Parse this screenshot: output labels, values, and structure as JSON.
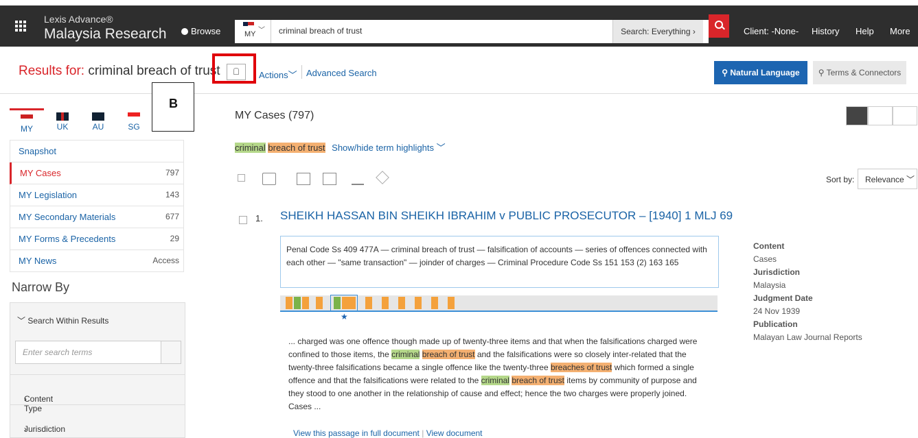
{
  "header": {
    "brand_top": "Lexis Advance®",
    "brand_main": "Malaysia Research",
    "browse_label": "Browse",
    "search": {
      "jurisdiction": "MY",
      "query": "criminal breach of trust",
      "scope_label": "Search: Everything",
      "scope_chevron": "›"
    },
    "nav": [
      "Client: -None-",
      "History",
      "Help",
      "More"
    ]
  },
  "results_bar": {
    "label": "Results for:",
    "query": "criminal breach of trust",
    "actions_label": "Actions",
    "advanced_search_label": "Advanced Search",
    "natural_language_label": "Natural Language",
    "terms_connectors_label": "Terms & Connectors"
  },
  "callout_label": "B",
  "jurisdiction_tabs": [
    {
      "code": "MY",
      "active": true
    },
    {
      "code": "UK",
      "active": false
    },
    {
      "code": "AU",
      "active": false
    },
    {
      "code": "SG",
      "active": false
    }
  ],
  "sidebar": {
    "items": [
      {
        "label": "Snapshot",
        "count": ""
      },
      {
        "label": "MY Cases",
        "count": "797"
      },
      {
        "label": "MY Legislation",
        "count": "143"
      },
      {
        "label": "MY Secondary Materials",
        "count": "677"
      },
      {
        "label": "MY Forms & Precedents",
        "count": "29"
      },
      {
        "label": "MY News",
        "count": "Access"
      }
    ],
    "narrow_by_label": "Narrow By",
    "search_within_label": "Search Within Results",
    "search_within_placeholder": "Enter search terms",
    "facets": [
      "Content Type",
      "Jurisdiction"
    ]
  },
  "main": {
    "cases_title": "MY Cases (797)",
    "terms": {
      "t1": "criminal",
      "t2": "breach of trust",
      "toggle_label": "Show/hide term highlights"
    },
    "sort_label": "Sort by:",
    "sort_value": "Relevance",
    "result": {
      "number": "1.",
      "title": "SHEIKH HASSAN BIN SHEIKH IBRAHIM v PUBLIC PROSECUTOR – [1940] 1 MLJ 69",
      "summary": "Penal Code Ss 409 477A — criminal breach of trust — falsification of accounts — series of offences connected with each other — \"same transaction\" — joinder of charges — Criminal Procedure Code Ss 151 153 (2) 163 165",
      "snippet": {
        "s1": "... charged was one offence though made up of twenty-three items and that when the falsifications charged were confined to those items, the ",
        "h1": "criminal",
        "s2": " ",
        "h2": "breach of trust",
        "s3": " and the falsifications were so closely inter-related that the twenty-three falsifications became a single offence like the twenty-three ",
        "h3": "breaches of trust",
        "s4": " which formed a single offence and that the falsifications were related to the ",
        "h4": "criminal",
        "s5": " ",
        "h5": "breach of trust",
        "s6": " items by community of purpose and they stood to one another in the relationship of cause and effect; hence the two charges were properly joined. Cases ..."
      },
      "view_passage_label": "View this passage in full document",
      "view_document_label": "View document",
      "meta": [
        {
          "key": "Content",
          "value": "Cases"
        },
        {
          "key": "Jurisdiction",
          "value": "Malaysia"
        },
        {
          "key": "Judgment Date",
          "value": "24 Nov 1939"
        },
        {
          "key": "Publication",
          "value": "Malayan Law Journal Reports"
        }
      ]
    }
  },
  "colors": {
    "accent_red": "#d9252a",
    "link_blue": "#1a63a6",
    "primary_blue": "#1d65b1",
    "highlight_green": "#b5d88a",
    "highlight_orange": "#f4b071",
    "topbar": "#2e2e2e"
  }
}
